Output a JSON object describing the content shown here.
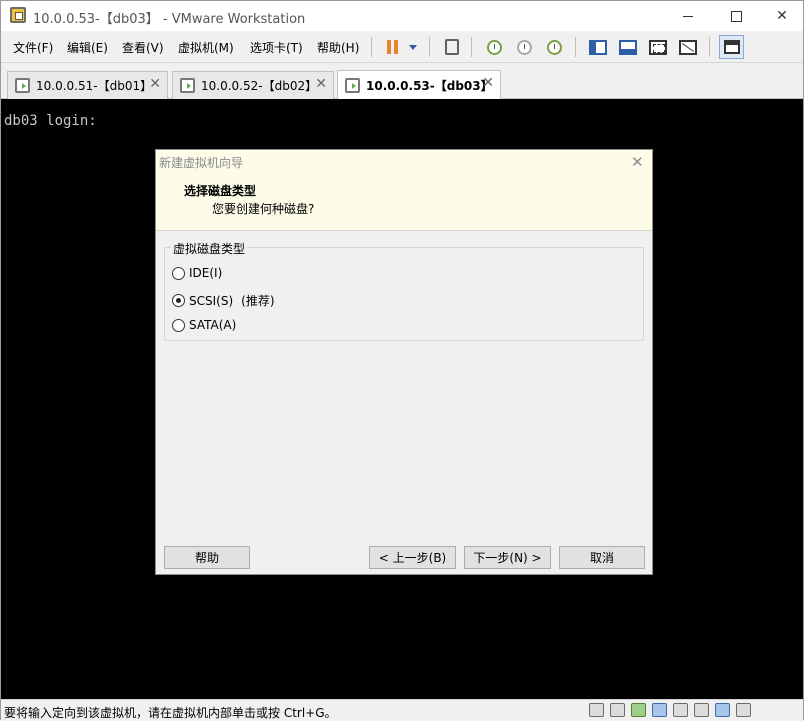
{
  "window": {
    "title": "10.0.0.53-【db03】 - VMware Workstation",
    "minimize_icon": "minimize-icon",
    "maximize_icon": "maximize-icon",
    "close_glyph": "✕"
  },
  "menu": {
    "items": [
      "文件(F)",
      "编辑(E)",
      "查看(V)",
      "虚拟机(M)",
      "选项卡(T)",
      "帮助(H)"
    ]
  },
  "toolbar": {
    "accent_pause": "#e8842c",
    "icons": [
      "pause-icon",
      "dropdown-icon",
      "send-ctrl-alt-del-icon",
      "snapshot-icon",
      "revert-snapshot-icon",
      "snapshot-manager-icon",
      "show-library-icon",
      "show-thumbnail-icon",
      "full-screen-icon",
      "unity-icon",
      "console-view-icon"
    ]
  },
  "tabs": [
    {
      "label": "10.0.0.51-【db01】",
      "close": "✕",
      "active": false
    },
    {
      "label": "10.0.0.52-【db02】",
      "close": "✕",
      "active": false
    },
    {
      "label": "10.0.0.53-【db03】",
      "close": "✕",
      "active": true
    }
  ],
  "console": {
    "text": "db03 login:",
    "background": "#000000"
  },
  "dialog": {
    "title": "新建虚拟机向导",
    "close_glyph": "✕",
    "heading": "选择磁盘类型",
    "subheading": "您要创建何种磁盘?",
    "group_label": "虚拟磁盘类型",
    "options": [
      {
        "label": "IDE(I)",
        "checked": false,
        "note": ""
      },
      {
        "label": "SCSI(S)",
        "checked": true,
        "note": "(推荐)"
      },
      {
        "label": "SATA(A)",
        "checked": false,
        "note": ""
      }
    ],
    "buttons": {
      "help": "帮助",
      "back": "< 上一步(B)",
      "next": "下一步(N) >",
      "cancel": "取消"
    }
  },
  "statusbar": {
    "text": "要将输入定向到该虚拟机，请在虚拟机内部单击或按 Ctrl+G。",
    "device_icons": [
      "hard-disk-icon",
      "cdrom-icon",
      "network-icon",
      "usb-icon",
      "sound-icon",
      "printer-icon",
      "display-icon",
      "message-icon"
    ]
  }
}
